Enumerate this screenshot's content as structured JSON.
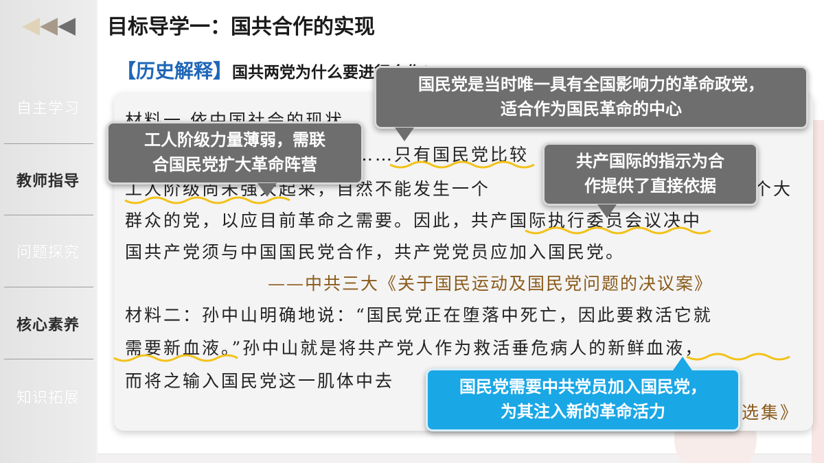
{
  "sidebar": {
    "items": [
      {
        "label": "自主学习",
        "active": false
      },
      {
        "label": "教师指导",
        "active": true
      },
      {
        "label": "问题探究",
        "active": false
      },
      {
        "label": "核心素养",
        "active": true
      },
      {
        "label": "知识拓展",
        "active": false
      }
    ]
  },
  "header": {
    "title": "目标导学一：国共合作的实现",
    "tag": "【历史解释】",
    "question": "国共两党为什么要进行合作?"
  },
  "material": {
    "lines": [
      "材料一  依中国社会的现状，",
      "……只有国民党比较",
      "工人阶级尚未强大起来，自然不能发生一个",
      "个大",
      "群众的党，以应目前革命之需要。因此，共产国际执行委员会议决中",
      "国共产党须与中国国民党合作，共产党党员应加入国民党。",
      "——中共三大《关于国民运动及国民党问题的决议案》",
      "材料二：孙中山明确地说：“国民党正在堕落中死亡，因此要救活它就",
      "需要新血液。”孙中山就是将共产党人作为救活垂危病人的新鲜血液，",
      "而将之输入国民党这一肌体中去",
      "选集》"
    ]
  },
  "callouts": {
    "top": {
      "line1": "国民党是当时唯一具有全国影响力的革命政党，",
      "line2": "适合作为国民革命的中心"
    },
    "left": {
      "line1": "工人阶级力量薄弱，需联",
      "line2": "合国民党扩大革命阵营"
    },
    "right": {
      "line1": "共产国际的指示为合",
      "line2": "作提供了直接依据"
    },
    "bottom": {
      "line1": "国民党需要中共党员加入国民党，",
      "line2": "为其注入新的革命活力"
    }
  },
  "colors": {
    "accent_blue": "#1e66b7",
    "callout_grey": "#6e6e6e",
    "callout_blue": "#1aa7e6",
    "underline": "#f2c21a",
    "source_brown": "#8a5a1a"
  }
}
